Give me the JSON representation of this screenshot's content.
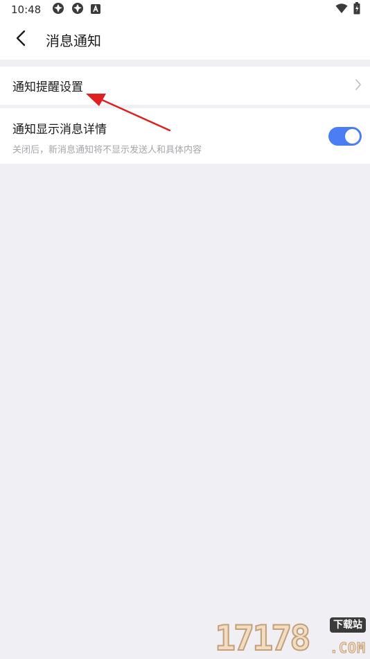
{
  "status_bar": {
    "time": "10:48",
    "icons_left": [
      "app-notification-icon",
      "app-notification-icon",
      "system-a-icon"
    ],
    "icons_right": [
      "wifi-icon",
      "battery-charging-icon"
    ]
  },
  "nav": {
    "back_icon": "chevron-left-icon",
    "title": "消息通知"
  },
  "settings": {
    "reminder": {
      "label": "通知提醒设置",
      "chevron_icon": "chevron-right-icon"
    },
    "show_details": {
      "title": "通知显示消息详情",
      "subtitle": "关闭后，新消息通知将不显示发送人和具体内容",
      "enabled": true
    }
  },
  "annotation": {
    "arrow_color": "#e02020"
  },
  "colors": {
    "accent": "#4b7df4",
    "background": "#efeff4",
    "surface": "#ffffff"
  },
  "watermark": {
    "number": "17178",
    "badge": "下载站",
    "domain": ".COM"
  }
}
